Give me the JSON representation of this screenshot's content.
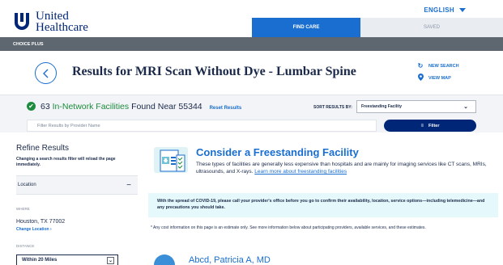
{
  "header": {
    "logo_line1": "United",
    "logo_line2": "Healthcare",
    "language": "ENGLISH",
    "nav_find_care": "FIND CARE",
    "nav_saved": "SAVED",
    "plan": "CHOICE PLUS"
  },
  "results": {
    "title": "Results for MRI Scan Without Dye - Lumbar Spine",
    "new_search": "NEW SEARCH",
    "view_map": "VIEW MAP",
    "count": "63",
    "in_network": "In-Network Facilities",
    "found_near": "Found Near 55344",
    "reset": "Reset Results",
    "sort_label": "SORT RESULTS BY:",
    "sort_value": "Freestanding Facility",
    "filter_placeholder": "Filter Results by Provider Name",
    "filter_button": "Filter"
  },
  "sidebar": {
    "title": "Refine Results",
    "description": "Changing a search results filter will reload the page immediately.",
    "location_heading": "Location",
    "where_label": "WHERE",
    "city": "Houston, TX 77002",
    "change_location": "Change Location",
    "distance_label": "DISTANCE",
    "distance_value": "Within 20 Miles"
  },
  "promo": {
    "title": "Consider a Freestanding Facility",
    "text": "These types of facilities are generally less expensive than hospitals and are mainly for imaging services like CT scans, MRIs, ultrasounds, and X-rays.",
    "link": "Learn more about freestanding facilities",
    "covid": "With the spread of COVID-19, please call your provider's office before you go to confirm their availability, location, service options—including telemedicine—and any precautions you should take.",
    "cost_note": "* Any cost information on this page is an estimate only. See more information below about participating providers, available services, and these estimates."
  },
  "provider": {
    "name": "Abcd, Patricia A, MD"
  },
  "colors": {
    "brand_blue": "#196ecf",
    "navy": "#002677",
    "in_network_green": "#1e8c3e",
    "covid_banner": "#e5f8fb"
  },
  "icons": {
    "back": "chevron-left-icon",
    "new_search": "refresh-icon",
    "view_map": "map-pin-icon",
    "found": "check-circle-icon",
    "filter": "filter-icon",
    "promo": "facility-clipboard-icon"
  }
}
